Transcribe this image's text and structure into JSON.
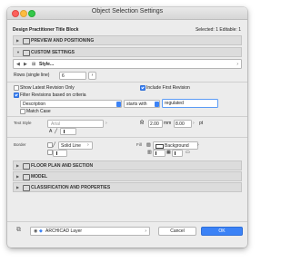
{
  "window": {
    "title": "Object Selection Settings"
  },
  "header": {
    "object_name": "Design Practitioner Title Block",
    "selected_info": "Selected: 1 Editable: 1"
  },
  "sections": {
    "preview": "PREVIEW AND POSITIONING",
    "custom": "CUSTOM SETTINGS",
    "floor_plan": "FLOOR PLAN AND SECTION",
    "model": "MODEL",
    "classification": "CLASSIFICATION AND PROPERTIES"
  },
  "custom_settings": {
    "style_label": "Style...",
    "rows_label": "Rows (single line)",
    "rows_value": "6",
    "show_latest_revision": {
      "label": "Show Latest Revision Only",
      "checked": false
    },
    "include_first_revision": {
      "label": "Include First Revision",
      "checked": true
    },
    "filter_revisions": {
      "label": "Filter Revisions based on criteria",
      "checked": true
    },
    "criteria_field": "Description",
    "criteria_operator": "starts with",
    "criteria_value": "regulated",
    "match_case": {
      "label": "Match Case",
      "checked": false
    }
  },
  "text_style": {
    "label": "Text Style",
    "font": "Arial",
    "size_value": "2.00",
    "size_unit": "mm",
    "pt_value": "8.00",
    "pt_unit": "pt",
    "extra": "A"
  },
  "border": {
    "label": "Border",
    "line_type": "Solid Line",
    "fill_label": "Fill",
    "fill_background": "Background"
  },
  "footer": {
    "layer": "ARCHICAD Layer",
    "cancel": "Cancel",
    "ok": "OK"
  },
  "colors": {
    "accent": "#3b82f6",
    "window_bg": "#ececec"
  }
}
